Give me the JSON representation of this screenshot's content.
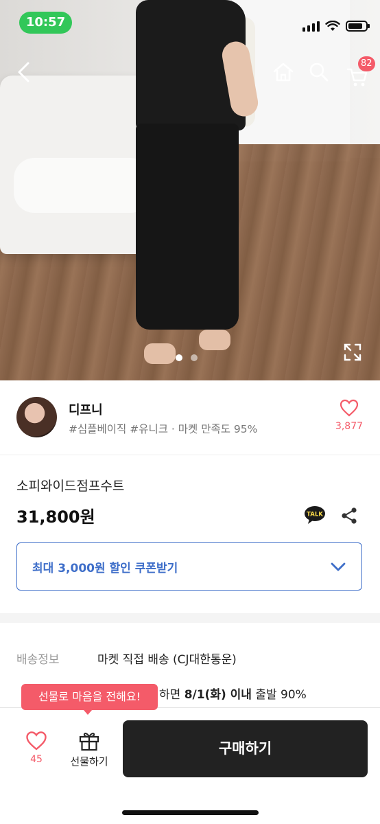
{
  "status_bar": {
    "time": "10:57"
  },
  "header": {
    "cart_badge": "82"
  },
  "hero": {
    "slide_count": 2,
    "active_slide": 0
  },
  "seller": {
    "name": "디프니",
    "tags": "#심플베이직 #유니크 · 마켓 만족도 95%",
    "like_count": "3,877"
  },
  "product": {
    "name": "소피와이드점프수트",
    "price": "31,800원",
    "talk_icon_text": "TALK"
  },
  "coupon": {
    "label": "최대 3,000원 할인 쿠폰받기"
  },
  "shipping": {
    "label": "배송정보",
    "value": "마켓 직접 배송 (CJ대한통운)",
    "depart_prefix": "하면 ",
    "depart_date": "8/1(화) 이내",
    "depart_suffix": " 출발 90%"
  },
  "bottom_bar": {
    "tooltip": "선물로 마음을 전해요!",
    "like_count": "45",
    "gift_label": "선물하기",
    "buy_label": "구매하기"
  },
  "colors": {
    "accent": "#f45b69",
    "link_blue": "#3e6ec9",
    "status_green": "#32c759"
  },
  "icons": [
    "back-icon",
    "home-icon",
    "search-icon",
    "cart-icon",
    "expand-icon",
    "heart-icon",
    "share-icon",
    "talk-icon",
    "chevron-down-icon",
    "gift-icon"
  ]
}
